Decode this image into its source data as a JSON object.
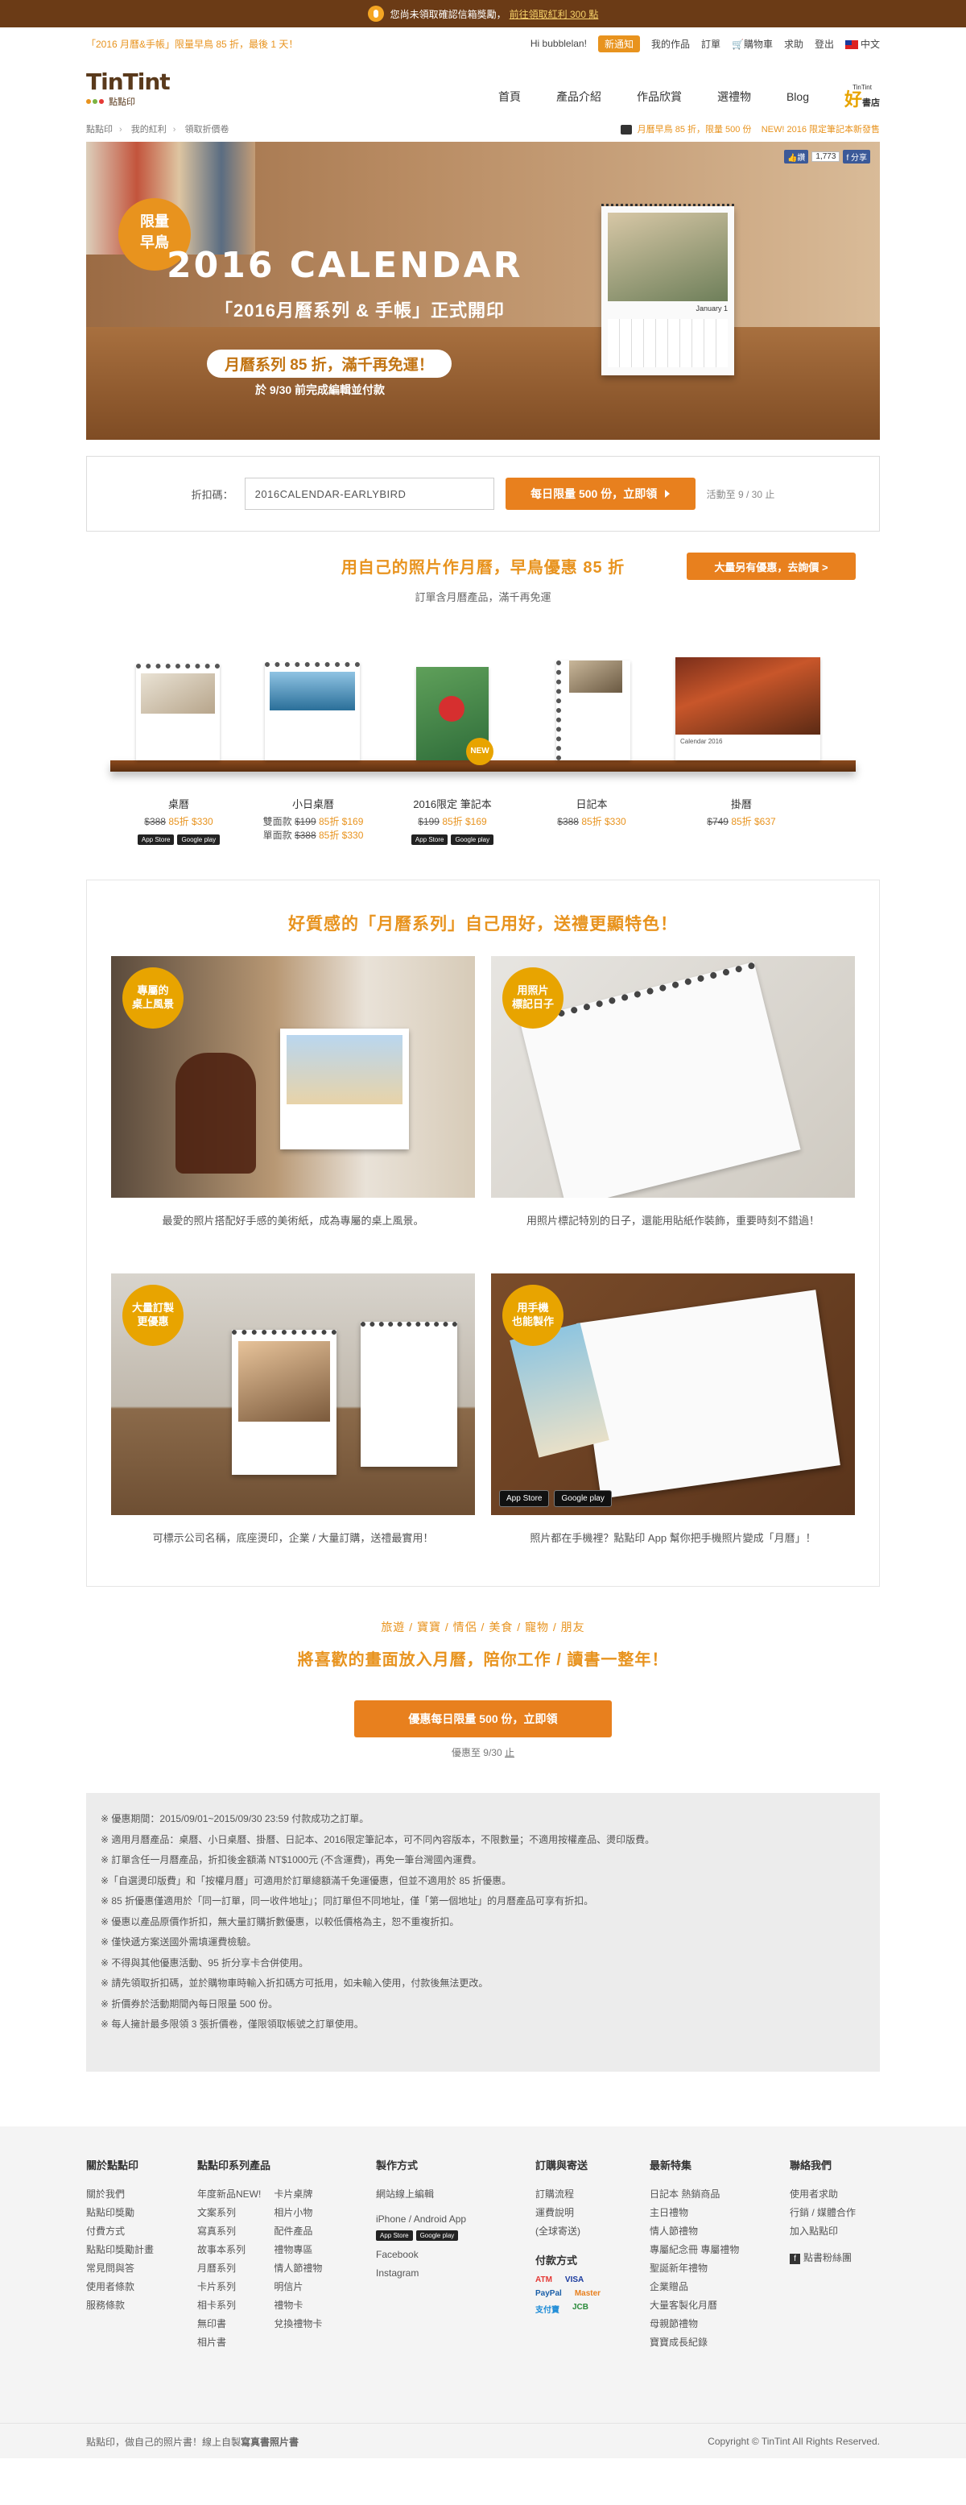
{
  "topbar": {
    "text": "您尚未領取確認信箱獎勵，",
    "link": "前往領取紅利 300 點"
  },
  "userbar": {
    "promo": "「2016 月曆&手帳」限量早鳥 85 折，最後 1 天！",
    "greeting": "Hi bubblelan!",
    "notice": "新通知",
    "links": [
      "我的作品",
      "訂單",
      "購物車",
      "求助",
      "登出"
    ],
    "language": "中文"
  },
  "header": {
    "logo_text": "TinTint",
    "logo_sub": "點點印",
    "nav": [
      "首頁",
      "產品介紹",
      "作品欣賞",
      "選禮物",
      "Blog"
    ],
    "store_small": "TinTint",
    "store_big": "好",
    "store_suffix": "書店"
  },
  "breadcrumb": {
    "items": [
      "點點印",
      "我的紅利",
      "領取折價卷"
    ],
    "notice1": "月曆早鳥 85 折，限量 500 份",
    "notice2": "NEW! 2016 限定筆記本新發售"
  },
  "hero": {
    "seal_line1": "限量",
    "seal_line2": "早鳥",
    "title": "2016 CALENDAR",
    "subtitle": "「2016月曆系列 & 手帳」正式開印",
    "pill": "月曆系列 85 折，滿千再免運！",
    "note": "於 9/30 前完成編輯並付款",
    "calendar_month": "January 1",
    "share_like": "讚",
    "share_count": "1,773",
    "share_label": "分享"
  },
  "coupon": {
    "label": "折扣碼：",
    "code": "2016CALENDAR-EARLYBIRD",
    "button": "每日限量 500 份，立即領",
    "valid": "活動至 9 / 30 止"
  },
  "offer": {
    "headline": "用自己的照片作月曆，早鳥優惠 85 折",
    "sub": "訂單含月曆產品，滿千再免運",
    "bulk_button": "大量另有優惠，去詢價 >"
  },
  "products": [
    {
      "name": "桌曆",
      "rows": [
        {
          "prefix": "",
          "old": "$388",
          "new": "85折 $330"
        }
      ],
      "apps": true
    },
    {
      "name": "小日桌曆",
      "rows": [
        {
          "prefix": "雙面款",
          "old": "$199",
          "new": "85折 $169"
        },
        {
          "prefix": "單面款",
          "old": "$388",
          "new": "85折 $330"
        }
      ],
      "apps": false
    },
    {
      "name": "2016限定 筆記本",
      "rows": [
        {
          "prefix": "",
          "old": "$199",
          "new": "85折 $169"
        }
      ],
      "apps": true
    },
    {
      "name": "日記本",
      "rows": [
        {
          "prefix": "",
          "old": "$388",
          "new": "85折 $330"
        }
      ],
      "apps": false
    },
    {
      "name": "掛曆",
      "rows": [
        {
          "prefix": "",
          "old": "$749",
          "new": "85折 $637"
        }
      ],
      "apps": false
    }
  ],
  "app_labels": {
    "appstore": "App Store",
    "googleplay": "Google play"
  },
  "new_badge": "NEW",
  "wall_calendar_label": "Calendar 2016",
  "features": {
    "headline": "好質感的「月曆系列」自己用好，送禮更顯特色！",
    "items": [
      {
        "badge1": "專屬的",
        "badge2": "桌上風景",
        "caption": "最愛的照片搭配好手感的美術紙，成為專屬的桌上風景。"
      },
      {
        "badge1": "用照片",
        "badge2": "標記日子",
        "caption": "用照片標記特別的日子，還能用貼紙作裝飾，重要時刻不錯過！"
      },
      {
        "badge1": "大量訂製",
        "badge2": "更優惠",
        "caption": "可標示公司名稱，底座燙印，企業 / 大量訂購，送禮最實用！"
      },
      {
        "badge1": "用手機",
        "badge2": "也能製作",
        "caption": "照片都在手機裡？點點印 App 幫你把手機照片變成「月曆」！"
      }
    ]
  },
  "cta": {
    "tags": "旅遊 / 寶寶 / 情侶 / 美食 / 寵物 / 朋友",
    "headline": "將喜歡的畫面放入月曆，陪你工作 / 讀書一整年！",
    "button": "優惠每日限量 500 份，立即領",
    "valid_prefix": "優惠至 9/30 ",
    "valid_suffix": "止"
  },
  "terms": [
    "※ 優惠期間：2015/09/01~2015/09/30 23:59 付款成功之訂單。",
    "※ 適用月曆產品：桌曆、小日桌曆、掛曆、日記本、2016限定筆記本，可不同內容版本，不限數量；不適用按權產品、燙印版費。",
    "※ 訂單含任一月曆產品，折扣後金額滿 NT$1000元 (不含運費)，再免一筆台灣國內運費。",
    "※「自選燙印版費」和「按權月曆」可適用於訂單總額滿千免運優惠，但並不適用於 85 折優惠。",
    "※ 85 折優惠僅適用於「同一訂單，同一收件地址」；同訂單但不同地址，僅「第一個地址」的月曆產品可享有折扣。",
    "※ 優惠以產品原價作折扣，無大量訂購折數優惠，以較低價格為主，恕不重複折扣。",
    "※ 僅快遞方案送國外需填運費檢驗。",
    "※ 不得與其他優惠活動、95 折分享卡合併使用。",
    "※ 請先領取折扣碼，並於購物車時輸入折扣碼方可抵用，如未輸入使用，付款後無法更改。",
    "※ 折價券於活動期間內每日限量 500 份。",
    "※ 每人擁計最多限領 3 張折價卷，僅限領取帳號之訂單使用。"
  ],
  "footer": {
    "col1": {
      "title": "關於點點印",
      "items": [
        "關於我們",
        "點點印獎勵",
        "付費方式",
        "點點印獎勵計畫",
        "常見問與答",
        "使用者條款",
        "服務條款"
      ]
    },
    "col2": {
      "title": "點點印系列產品",
      "items_a": [
        "年度新品NEW!",
        "文案系列",
        "寫真系列",
        "故事本系列",
        "月曆系列",
        "卡片系列",
        "相卡系列",
        "無印書",
        "相片書"
      ],
      "items_b": [
        "卡片桌牌",
        "相片小物",
        "配件產品",
        "禮物專區",
        "情人節禮物",
        "明信片",
        "禮物卡",
        "兌換禮物卡"
      ]
    },
    "col3": {
      "title": "製作方式",
      "items": [
        "網站線上編輯",
        "iPhone / Android App",
        "Facebook",
        "Instagram"
      ]
    },
    "col4": {
      "title": "訂購與寄送",
      "items": [
        "訂購流程",
        "運費說明",
        "(全球寄送)"
      ],
      "pay_title": "付款方式",
      "pay": [
        "ATM",
        "VISA",
        "PayPal",
        "Master",
        "支付寶",
        "JCB"
      ]
    },
    "col5": {
      "title": "最新特集",
      "items": [
        "日記本 熱銷商品",
        "主日禮物",
        "情人節禮物",
        "專屬紀念冊 專屬禮物",
        "聖誕新年禮物",
        "企業贈品",
        "大量客製化月曆",
        "母親節禮物",
        "寶寶成長紀錄"
      ]
    },
    "col6": {
      "title": "聯絡我們",
      "items": [
        "使用者求助",
        "行銷 / 媒體合作",
        "加入點點印"
      ],
      "fb": "點書粉絲團"
    },
    "bottom_left_prefix": "點點印，做自己的照片書！線上自製",
    "bottom_left_bold": "寫真書照片書",
    "copyright": "Copyright © TinTint All Rights Reserved."
  },
  "colors": {
    "accent": "#e8931e",
    "topbar": "#6b3b16",
    "shelf": "#7a3f17"
  }
}
